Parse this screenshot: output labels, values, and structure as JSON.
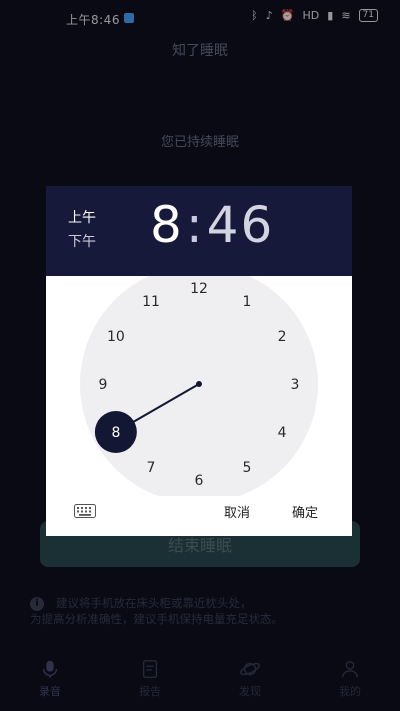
{
  "status_bar": {
    "time": "上午8:46",
    "battery": "71",
    "network": "HD"
  },
  "page": {
    "title": "知了睡眠",
    "sleep_status": "您已持续睡眠",
    "end_button_label": "结束睡眠",
    "tip_line1": "建议将手机放在床头柜或靠近枕头处，",
    "tip_line2": "为提高分析准确性，建议手机保持电量充足状态。"
  },
  "bottom_nav": {
    "items": [
      {
        "label": "录音",
        "icon": "microphone-icon"
      },
      {
        "label": "报告",
        "icon": "document-icon"
      },
      {
        "label": "发现",
        "icon": "planet-icon"
      },
      {
        "label": "我的",
        "icon": "person-icon"
      }
    ]
  },
  "time_picker": {
    "am_label": "上午",
    "pm_label": "下午",
    "selected_period": "上午",
    "hour": "8",
    "separator": ":",
    "minute": "46",
    "hour_numbers": [
      "12",
      "1",
      "2",
      "3",
      "4",
      "5",
      "6",
      "7",
      "8",
      "9",
      "10",
      "11"
    ],
    "selected_hour": 8,
    "cancel_label": "取消",
    "ok_label": "确定",
    "keyboard_icon": "keyboard-icon"
  },
  "colors": {
    "background": "#0f1020",
    "dialog_header": "#16193a",
    "dial_face": "#efeff2",
    "selection": "#141733",
    "end_button": "#2a4a50"
  }
}
